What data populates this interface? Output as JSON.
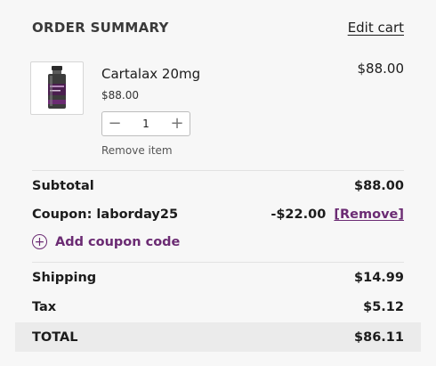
{
  "header": {
    "title": "ORDER SUMMARY",
    "edit_cart_label": "Edit cart"
  },
  "item": {
    "name": "Cartalax 20mg",
    "unit_price": "$88.00",
    "line_total": "$88.00",
    "quantity": "1",
    "remove_label": "Remove item",
    "thumbnail_icon": "product-vial-icon"
  },
  "summary": {
    "subtotal_label": "Subtotal",
    "subtotal_value": "$88.00",
    "coupon_label": "Coupon: laborday25",
    "coupon_value": "-$22.00",
    "coupon_remove_label": "[Remove]",
    "add_coupon_label": "Add coupon code",
    "shipping_label": "Shipping",
    "shipping_value": "$14.99",
    "tax_label": "Tax",
    "tax_value": "$5.12",
    "total_label": "TOTAL",
    "total_value": "$86.11"
  },
  "colors": {
    "accent": "#6b2b73",
    "background": "#f7f7f7",
    "total_bar": "#ebebeb"
  }
}
